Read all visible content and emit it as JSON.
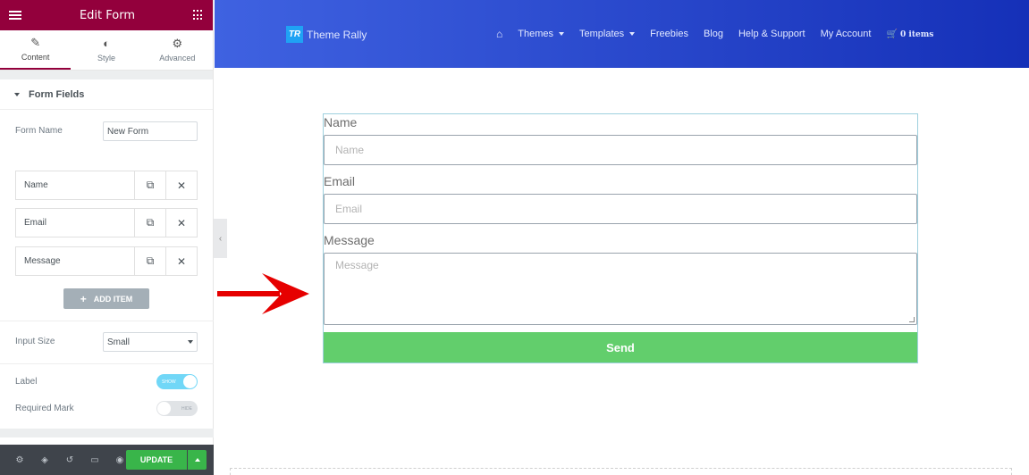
{
  "panel": {
    "title": "Edit Form",
    "tabs": [
      {
        "label": "Content",
        "icon": "pencil-icon"
      },
      {
        "label": "Style",
        "icon": "half-circle-icon"
      },
      {
        "label": "Advanced",
        "icon": "gear-icon"
      }
    ],
    "section_title": "Form Fields",
    "form_name_label": "Form Name",
    "form_name_value": "New Form",
    "fields": [
      {
        "label": "Name"
      },
      {
        "label": "Email"
      },
      {
        "label": "Message"
      }
    ],
    "add_item_label": "ADD ITEM",
    "input_size_label": "Input Size",
    "input_size_value": "Small",
    "label_label": "Label",
    "label_toggle_text": "SHOW",
    "required_mark_label": "Required Mark",
    "required_toggle_text": "HIDE",
    "update_label": "UPDATE"
  },
  "site": {
    "logo_mark": "TR",
    "logo_text": "Theme Rally",
    "nav": [
      "Themes",
      "Templates",
      "Freebies",
      "Blog",
      "Help & Support",
      "My Account"
    ],
    "cart_label": "0 items"
  },
  "form": {
    "name_label": "Name",
    "name_placeholder": "Name",
    "email_label": "Email",
    "email_placeholder": "Email",
    "message_label": "Message",
    "message_placeholder": "Message",
    "send_label": "Send"
  },
  "colors": {
    "panel_header": "#93003c",
    "header_gradient_start": "#3f62e1",
    "header_gradient_end": "#1530b8",
    "send_button": "#62ce6c",
    "update_button": "#39b54a",
    "arrow": "#e60000"
  }
}
